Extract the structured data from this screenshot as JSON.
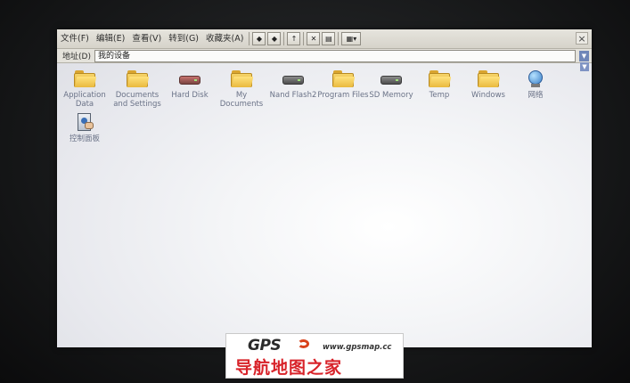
{
  "menubar": {
    "items": [
      "文件(F)",
      "编辑(E)",
      "查看(V)",
      "转到(G)",
      "收藏夹(A)"
    ],
    "toolbar_icons": [
      "back-icon",
      "forward-icon",
      "up-folder-icon",
      "delete-icon",
      "properties-icon",
      "views-icon"
    ],
    "close": "×"
  },
  "address": {
    "label": "地址(D)",
    "value": "我的设备"
  },
  "files": [
    {
      "label": "Application Data",
      "icon": "folder-icon"
    },
    {
      "label": "Documents and Settings",
      "icon": "folder-icon"
    },
    {
      "label": "Hard Disk",
      "icon": "hard-disk-icon"
    },
    {
      "label": "My Documents",
      "icon": "folder-icon"
    },
    {
      "label": "Nand Flash2",
      "icon": "flash-drive-icon"
    },
    {
      "label": "Program Files",
      "icon": "folder-icon"
    },
    {
      "label": "SD Memory",
      "icon": "storage-card-icon"
    },
    {
      "label": "Temp",
      "icon": "folder-icon"
    },
    {
      "label": "Windows",
      "icon": "folder-icon"
    },
    {
      "label": "网络",
      "icon": "network-icon"
    },
    {
      "label": "控制面板",
      "icon": "control-panel-icon"
    }
  ],
  "watermark": {
    "logo": "GPS",
    "url": "www.gpsmap.cc",
    "site_name": "导航地图之家"
  },
  "colors": {
    "menubar": "#d6d3ca",
    "screen": "#f4f5f7",
    "label_text": "#6a7287",
    "watermark_red": "#d8232a"
  }
}
